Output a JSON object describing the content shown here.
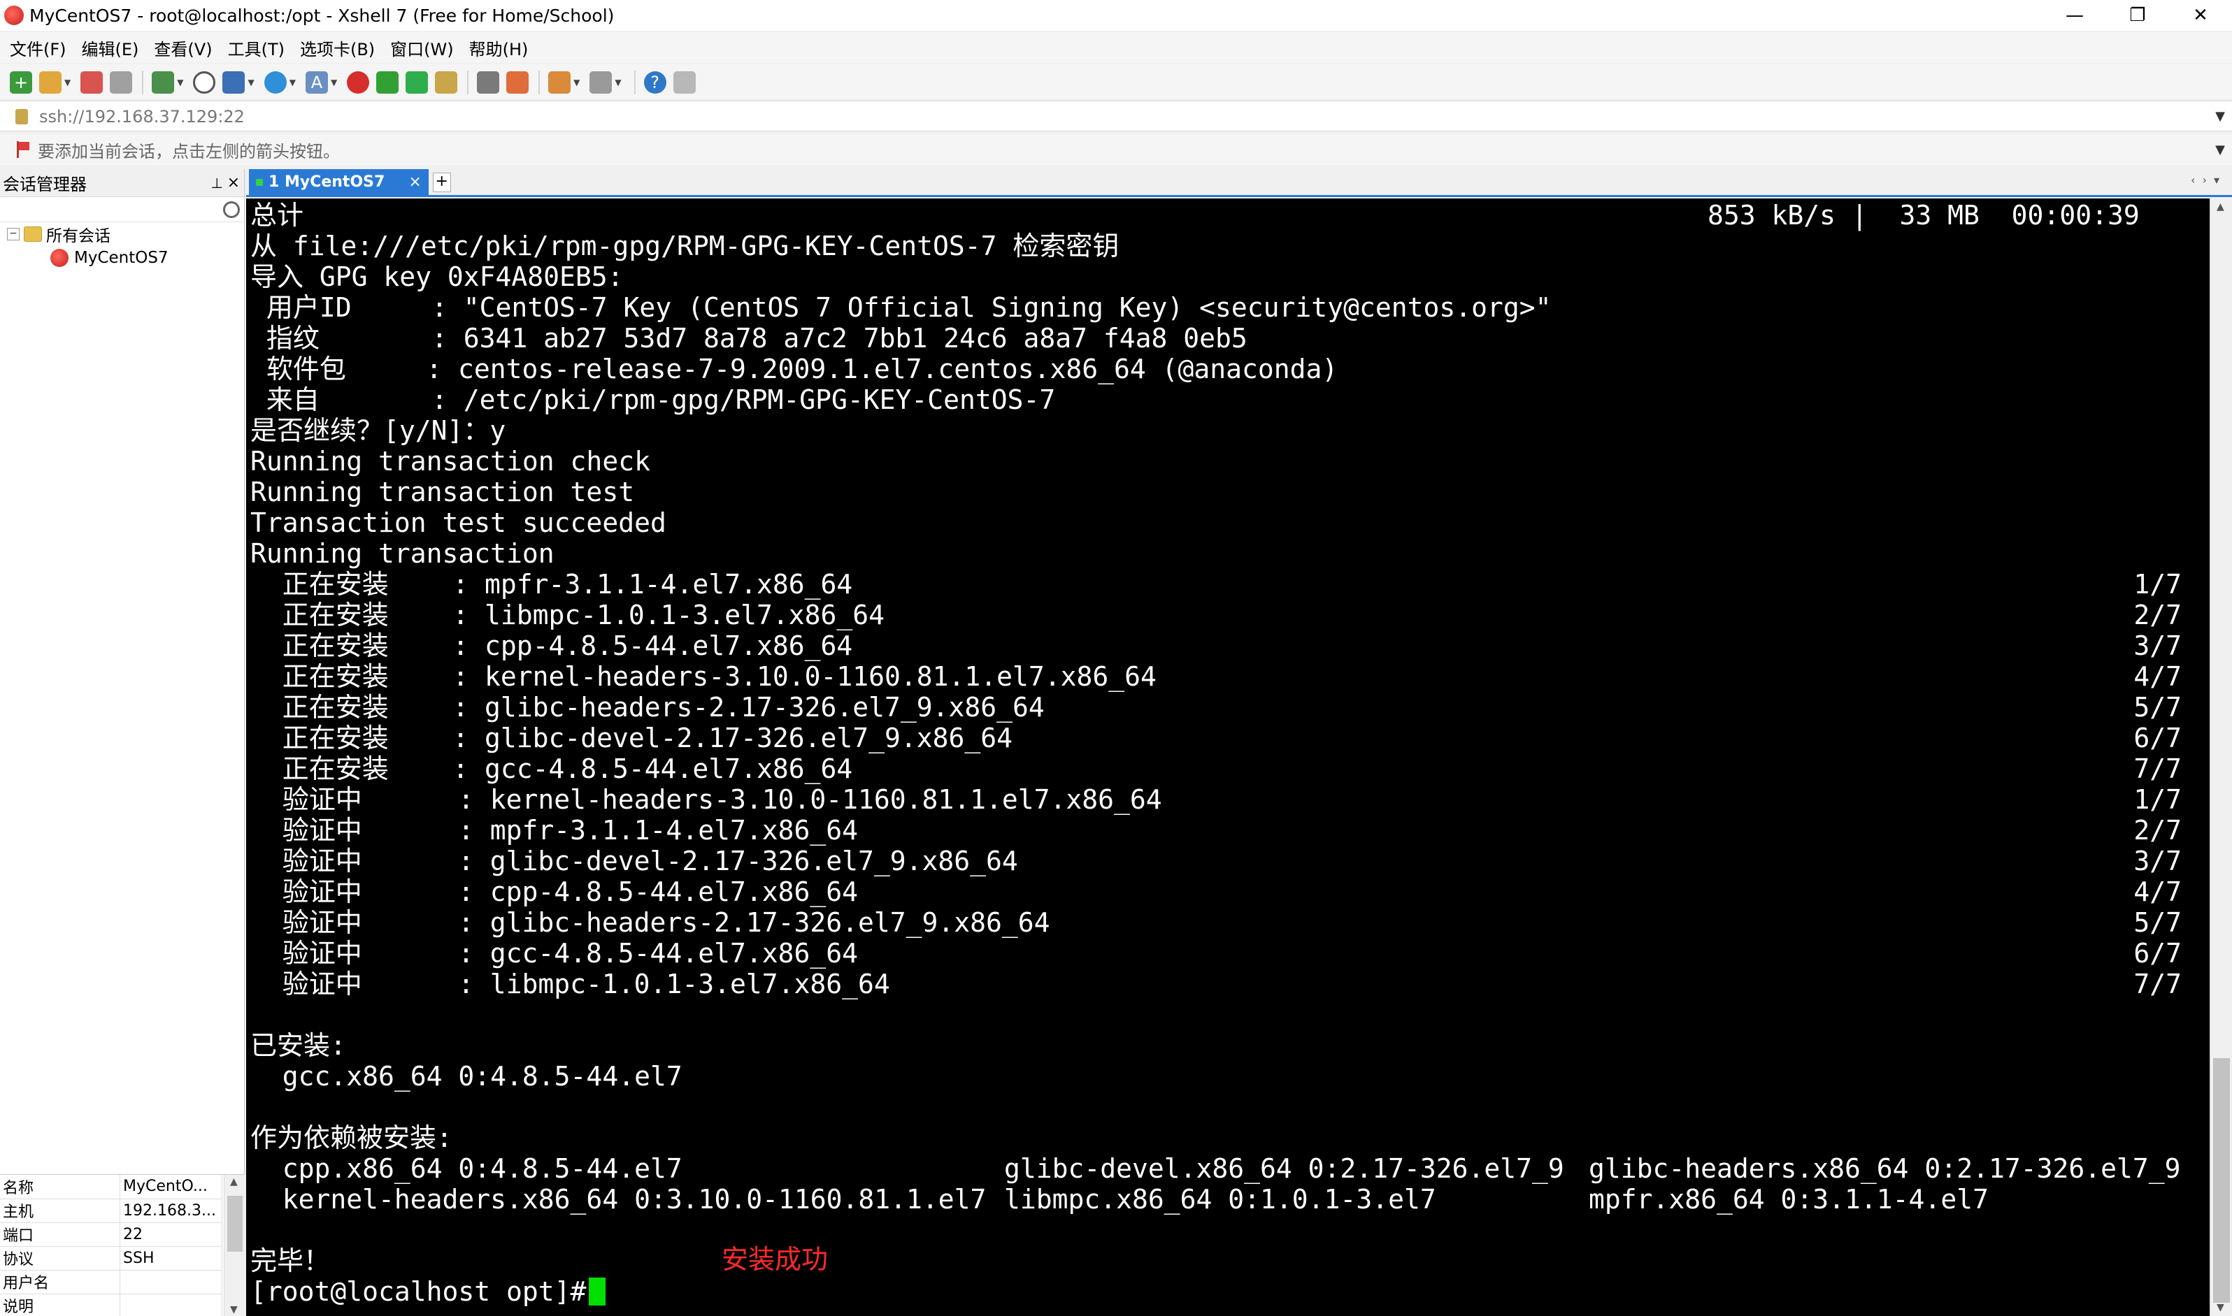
{
  "window": {
    "title": "MyCentOS7 - root@localhost:/opt - Xshell 7 (Free for Home/School)",
    "minimize": "—",
    "maximize": "❐",
    "close": "✕"
  },
  "menu": [
    "文件(F)",
    "编辑(E)",
    "查看(V)",
    "工具(T)",
    "选项卡(B)",
    "窗口(W)",
    "帮助(H)"
  ],
  "address": {
    "value": "ssh://192.168.37.129:22"
  },
  "hint": {
    "text": "要添加当前会话，点击左侧的箭头按钮。"
  },
  "session_panel": {
    "title": "会话管理器",
    "tree_root": "所有会话",
    "tree_child": "MyCentOS7"
  },
  "properties": {
    "rows": [
      {
        "key": "名称",
        "value": "MyCentO..."
      },
      {
        "key": "主机",
        "value": "192.168.3..."
      },
      {
        "key": "端口",
        "value": "22"
      },
      {
        "key": "协议",
        "value": "SSH"
      },
      {
        "key": "用户名",
        "value": ""
      },
      {
        "key": "说明",
        "value": ""
      }
    ]
  },
  "tab": {
    "label": "1 MyCentOS7",
    "close": "×",
    "new": "+"
  },
  "terminal": {
    "header_left": "总计",
    "header_right": "853 kB/s |  33 MB  00:00:39",
    "lines": [
      "从 file:///etc/pki/rpm-gpg/RPM-GPG-KEY-CentOS-7 检索密钥",
      "导入 GPG key 0xF4A80EB5:",
      " 用户ID     : \"CentOS-7 Key (CentOS 7 Official Signing Key) <security@centos.org>\"",
      " 指纹       : 6341 ab27 53d7 8a78 a7c2 7bb1 24c6 a8a7 f4a8 0eb5",
      " 软件包     : centos-release-7-9.2009.1.el7.centos.x86_64 (@anaconda)",
      " 来自       : /etc/pki/rpm-gpg/RPM-GPG-KEY-CentOS-7",
      "是否继续？[y/N]：y",
      "Running transaction check",
      "Running transaction test",
      "Transaction test succeeded",
      "Running transaction"
    ],
    "steps": [
      {
        "text": "  正在安装    : mpfr-3.1.1-4.el7.x86_64",
        "count": "1/7"
      },
      {
        "text": "  正在安装    : libmpc-1.0.1-3.el7.x86_64",
        "count": "2/7"
      },
      {
        "text": "  正在安装    : cpp-4.8.5-44.el7.x86_64",
        "count": "3/7"
      },
      {
        "text": "  正在安装    : kernel-headers-3.10.0-1160.81.1.el7.x86_64",
        "count": "4/7"
      },
      {
        "text": "  正在安装    : glibc-headers-2.17-326.el7_9.x86_64",
        "count": "5/7"
      },
      {
        "text": "  正在安装    : glibc-devel-2.17-326.el7_9.x86_64",
        "count": "6/7"
      },
      {
        "text": "  正在安装    : gcc-4.8.5-44.el7.x86_64",
        "count": "7/7"
      },
      {
        "text": "  验证中      : kernel-headers-3.10.0-1160.81.1.el7.x86_64",
        "count": "1/7"
      },
      {
        "text": "  验证中      : mpfr-3.1.1-4.el7.x86_64",
        "count": "2/7"
      },
      {
        "text": "  验证中      : glibc-devel-2.17-326.el7_9.x86_64",
        "count": "3/7"
      },
      {
        "text": "  验证中      : cpp-4.8.5-44.el7.x86_64",
        "count": "4/7"
      },
      {
        "text": "  验证中      : glibc-headers-2.17-326.el7_9.x86_64",
        "count": "5/7"
      },
      {
        "text": "  验证中      : gcc-4.8.5-44.el7.x86_64",
        "count": "6/7"
      },
      {
        "text": "  验证中      : libmpc-1.0.1-3.el7.x86_64",
        "count": "7/7"
      }
    ],
    "installed_label": "已安装:",
    "installed_pkg": "  gcc.x86_64 0:4.8.5-44.el7",
    "deps_label": "作为依赖被安装:",
    "deps_row1": [
      "  cpp.x86_64 0:4.8.5-44.el7",
      "glibc-devel.x86_64 0:2.17-326.el7_9",
      "glibc-headers.x86_64 0:2.17-326.el7_9"
    ],
    "deps_row2": [
      "  kernel-headers.x86_64 0:3.10.0-1160.81.1.el7",
      "libmpc.x86_64 0:1.0.1-3.el7",
      "mpfr.x86_64 0:3.1.1-4.el7"
    ],
    "done": "完毕！",
    "annotation": "安装成功",
    "prompt": "[root@localhost opt]# "
  },
  "colors": {
    "tab_accent": "#2a7ad5",
    "terminal_bg": "#000000",
    "terminal_fg": "#ffffff",
    "cursor": "#00e000",
    "annotation": "#ff2a2a"
  }
}
